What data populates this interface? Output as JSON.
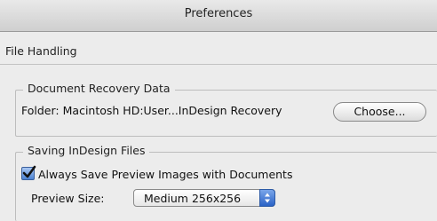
{
  "window": {
    "title": "Preferences"
  },
  "section": {
    "label": "File Handling"
  },
  "recovery": {
    "legend": "Document Recovery Data",
    "folder_label": "Folder:",
    "folder_path": "Macintosh HD:User...InDesign Recovery",
    "choose_label": "Choose..."
  },
  "saving": {
    "legend": "Saving InDesign Files",
    "checkbox_label": "Always Save Preview Images with Documents",
    "checkbox_checked": true,
    "checkbox_icon": "checkmark-icon",
    "preview_label": "Preview Size:",
    "preview_value": "Medium 256x256",
    "preview_icon": "updown-arrows-icon"
  }
}
